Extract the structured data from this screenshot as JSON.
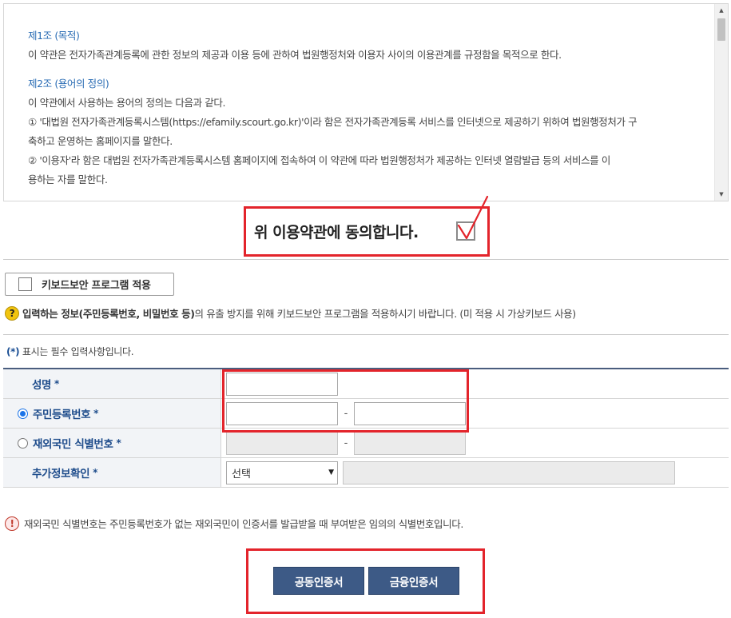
{
  "terms": {
    "article1_title": "제1조 (목적)",
    "article1_text": "이 약관은 전자가족관계등록에 관한 정보의 제공과 이용 등에 관하여 법원행정처와 이용자 사이의 이용관계를 규정함을 목적으로 한다.",
    "article2_title": "제2조 (용어의 정의)",
    "article2_intro": "이 약관에서 사용하는 용어의 정의는 다음과 같다.",
    "article2_item1a": "① '대법원 전자가족관계등록시스템(https://efamily.scourt.go.kr)'이라 함은 전자가족관계등록 서비스를 인터넷으로 제공하기 위하여 법원행정처가 구",
    "article2_item1b": "축하고 운영하는 홈페이지를 말한다.",
    "article2_item2a": "② '이용자'라 함은 대법원 전자가족관계등록시스템 홈페이지에 접속하여 이 약관에 따라 법원행정처가 제공하는 인터넷 열람발급 등의 서비스를 이",
    "article2_item2b": "용하는 자를 말한다."
  },
  "agree": {
    "label": "위 이용약관에 동의합니다.",
    "checked": true
  },
  "keyboard_security": {
    "button_label": "키보드보안 프로그램 적용",
    "notice_strong": "입력하는 정보(주민등록번호, 비밀번호 등)",
    "notice_rest": "의 유출 방지를 위해 키보드보안 프로그램을 적용하시기 바랍니다. (미 적용 시 가상키보드 사용)"
  },
  "required_note": {
    "star": "(*)",
    "text": " 표시는 필수 입력사항입니다."
  },
  "form": {
    "name_label": "성명",
    "rrn_label": "주민등록번호",
    "foreign_label": "재외국민 식별번호",
    "extra_label": "추가정보확인",
    "star": "*",
    "dash": "-",
    "select_value": "선택",
    "rrn_selected": true
  },
  "warning": "재외국민 식별번호는 주민등록번호가 없는 재외국민이 인증서를 발급받을 때 부여받은 임의의 식별번호입니다.",
  "buttons": {
    "public_cert": "공동인증서",
    "financial_cert": "금융인증서"
  },
  "colors": {
    "accent": "#3d5a86",
    "highlight": "#e3242b",
    "label_blue": "#1f4d8c"
  }
}
